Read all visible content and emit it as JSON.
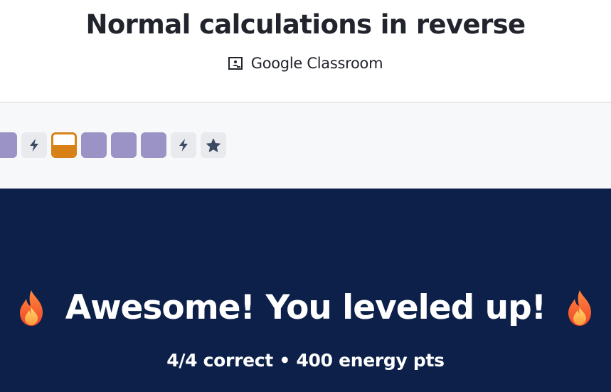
{
  "header": {
    "title": "Normal calculations in reverse",
    "classroom_label": "Google Classroom",
    "classroom_icon": "google-classroom-icon"
  },
  "progress": {
    "steps": [
      {
        "kind": "completed"
      },
      {
        "kind": "energy",
        "icon": "lightning-icon"
      },
      {
        "kind": "current",
        "fill_fraction": 0.5
      },
      {
        "kind": "completed"
      },
      {
        "kind": "completed"
      },
      {
        "kind": "completed"
      },
      {
        "kind": "energy",
        "icon": "lightning-icon"
      },
      {
        "kind": "mastery",
        "icon": "star-icon"
      }
    ],
    "colors": {
      "completed": "#9b92c5",
      "current": "#d88116",
      "icon_bg": "#e8eaee",
      "icon_fg": "#3b4a63"
    }
  },
  "banner": {
    "headline": "Awesome! You leveled up!",
    "icon": "fire-icon",
    "summary": "4/4 correct • 400 energy pts",
    "background": "#0c2049"
  }
}
